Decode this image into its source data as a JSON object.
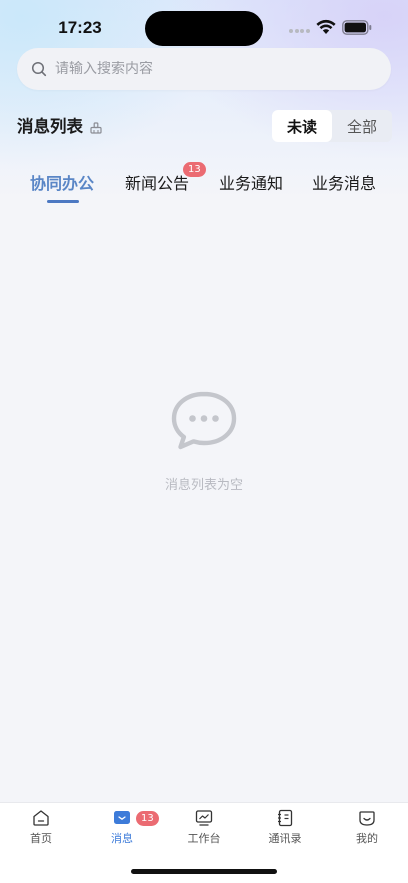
{
  "status_bar": {
    "time": "17:23"
  },
  "search": {
    "placeholder": "请输入搜索内容"
  },
  "header": {
    "title": "消息列表",
    "segments": [
      "未读",
      "全部"
    ],
    "active_segment": "未读"
  },
  "tabs": [
    {
      "label": "协同办公",
      "active": true
    },
    {
      "label": "新闻公告",
      "badge": "13"
    },
    {
      "label": "业务通知"
    },
    {
      "label": "业务消息"
    }
  ],
  "empty_state": {
    "text": "消息列表为空",
    "icon": "chat-bubble-icon"
  },
  "bottom_nav": [
    {
      "label": "首页",
      "icon": "home-icon"
    },
    {
      "label": "消息",
      "icon": "message-icon",
      "badge": "13",
      "active": true
    },
    {
      "label": "工作台",
      "icon": "workbench-icon"
    },
    {
      "label": "通讯录",
      "icon": "contacts-icon"
    },
    {
      "label": "我的",
      "icon": "profile-icon"
    }
  ],
  "colors": {
    "accent": "#4c78c2",
    "badge": "#eb6b72",
    "active_nav": "#3d7bd9"
  }
}
